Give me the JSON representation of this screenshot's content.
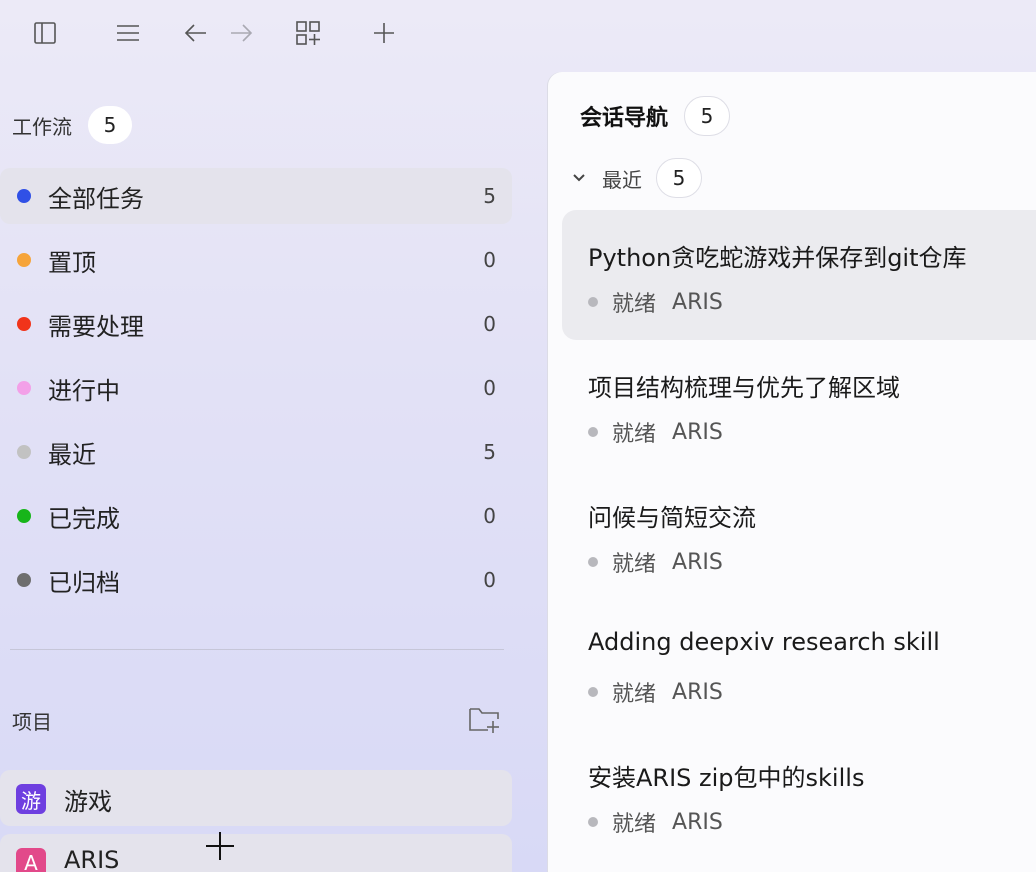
{
  "toolbar": {
    "icons": [
      "sidebar-toggle-icon",
      "menu-icon",
      "arrow-left-icon",
      "arrow-right-icon",
      "widgets-add-icon",
      "plus-icon"
    ]
  },
  "workflow": {
    "title": "工作流",
    "count": "5",
    "items": [
      {
        "label": "全部任务",
        "count": "5",
        "color": "#3050e6"
      },
      {
        "label": "置顶",
        "count": "0",
        "color": "#f6a43a"
      },
      {
        "label": "需要处理",
        "count": "0",
        "color": "#f1341a"
      },
      {
        "label": "进行中",
        "count": "0",
        "color": "#f3a0e8"
      },
      {
        "label": "最近",
        "count": "5",
        "color": "#c2c2c2"
      },
      {
        "label": "已完成",
        "count": "0",
        "color": "#17b51a"
      },
      {
        "label": "已归档",
        "count": "0",
        "color": "#6e6e6e"
      }
    ]
  },
  "projects": {
    "title": "项目",
    "items": [
      {
        "badge": "游",
        "label": "游戏",
        "color": "#6e3fe0"
      },
      {
        "badge": "A",
        "label": "ARIS",
        "color": "#e2498a"
      }
    ]
  },
  "panel": {
    "title": "会话导航",
    "count": "5",
    "group": {
      "label": "最近",
      "count": "5"
    },
    "sessions": [
      {
        "title": "Python贪吃蛇游戏并保存到git仓库",
        "status": "就绪",
        "project": "ARIS"
      },
      {
        "title": "项目结构梳理与优先了解区域",
        "status": "就绪",
        "project": "ARIS"
      },
      {
        "title": "问候与简短交流",
        "status": "就绪",
        "project": "ARIS"
      },
      {
        "title": "Adding deepxiv research skill",
        "status": "就绪",
        "project": "ARIS"
      },
      {
        "title": "安装ARIS zip包中的skills",
        "status": "就绪",
        "project": "ARIS"
      }
    ]
  }
}
